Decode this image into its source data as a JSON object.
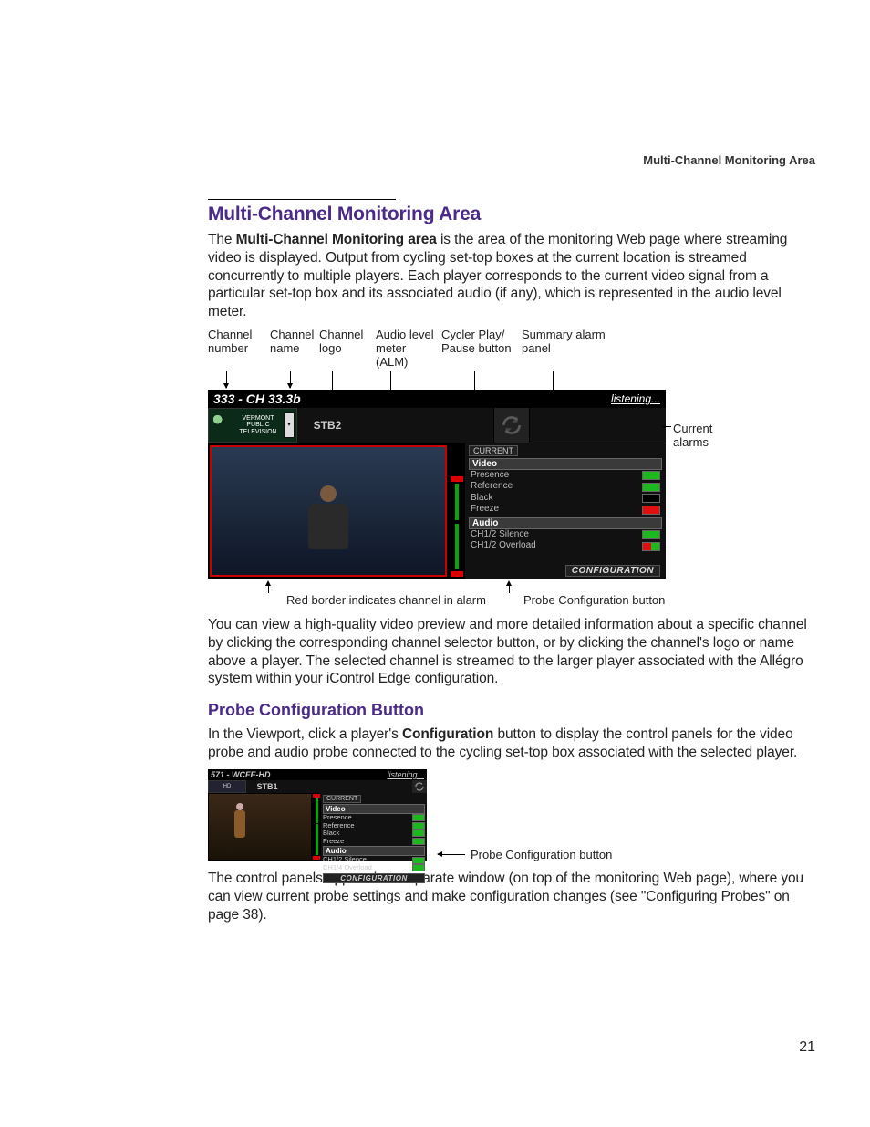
{
  "runningHead": "Multi-Channel Monitoring Area",
  "section1": {
    "title": "Multi-Channel Monitoring Area",
    "para1_pre": "The ",
    "para1_bold": "Multi-Channel Monitoring area",
    "para1_post": " is the area of the monitoring Web page where streaming video is displayed. Output from cycling set-top boxes at the current location is streamed concurrently to multiple players. Each player corresponds to the current video signal from a particular set-top box and its associated audio (if any), which is represented in the audio level meter."
  },
  "fig1": {
    "callouts": {
      "c1": "Channel\nnumber",
      "c2": "Channel\nname",
      "c3": "Channel\nlogo",
      "c4": "Audio level\nmeter (ALM)",
      "c5": "Cycler Play/\nPause button",
      "c6": "Summary alarm\npanel",
      "side": "Current\nalarms",
      "below_left": "Red border indicates channel in alarm",
      "below_right": "Probe Configuration button"
    },
    "player": {
      "title": "333 - CH 33.3b",
      "listening": "listening...",
      "logoText": "VERMONT\nPUBLIC\nTELEVISION",
      "stb": "STB2",
      "summary": {
        "current": "CURRENT",
        "video": "Video",
        "presence": "Presence",
        "reference": "Reference",
        "black": "Black",
        "freeze": "Freeze",
        "audio": "Audio",
        "silence": "CH1/2 Silence",
        "overload": "CH1/2 Overload",
        "config": "CONFIGURATION"
      }
    }
  },
  "para2": "You can view a high-quality video preview and more detailed information about a specific channel by clicking the corresponding channel selector button, or by clicking the channel's logo or name above a player. The selected channel is streamed to the larger player associated with the Allégro system within your iControl Edge configuration.",
  "section2": {
    "title": "Probe Configuration Button",
    "para_pre": "In the Viewport, click a player's ",
    "para_bold": "Configuration",
    "para_post": " button to display the control panels for the video probe and audio probe connected to the cycling set-top box associated with the selected player."
  },
  "fig2": {
    "player": {
      "title": "571 - WCFE-HD",
      "listening": "listening...",
      "logo": "HD",
      "stb": "STB1",
      "summary": {
        "current": "CURRENT",
        "video": "Video",
        "presence": "Presence",
        "reference": "Reference",
        "black": "Black",
        "freeze": "Freeze",
        "audio": "Audio",
        "silence": "CH1/2 Silence",
        "overload": "CH1/4 Overload",
        "config": "CONFIGURATION"
      }
    },
    "callout": "Probe Configuration button"
  },
  "para3": "The control panels appear in a separate window (on top of the monitoring Web page), where you can view current probe settings and make configuration changes (see \"Configuring Probes\" on page 38).",
  "pageNumber": "21"
}
